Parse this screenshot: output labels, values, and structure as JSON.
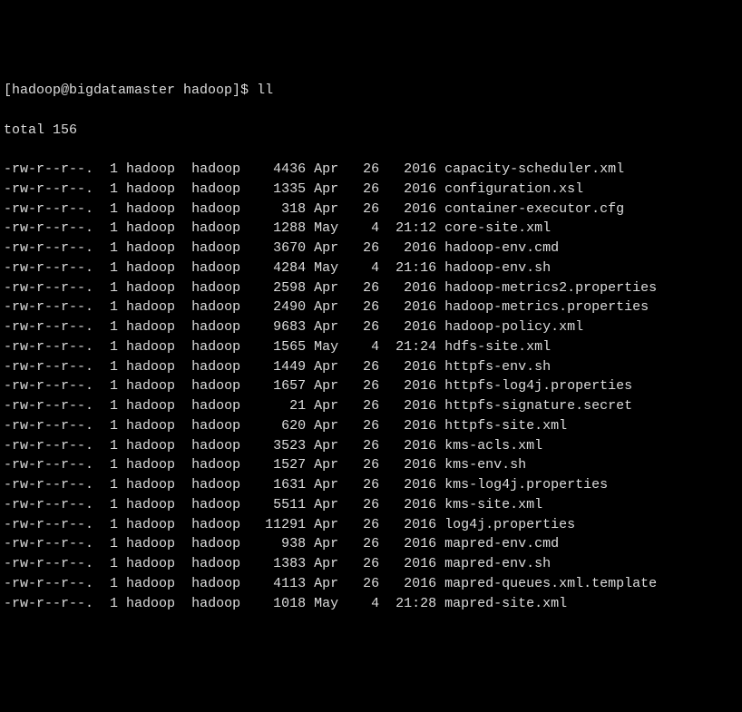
{
  "prompt": {
    "userhost": "[hadoop@bigdatamaster hadoop]$",
    "command": "ll"
  },
  "total_line": "total 156",
  "files": [
    {
      "perms": "-rw-r--r--.",
      "links": "1",
      "owner": "hadoop",
      "group": "hadoop",
      "size": "4436",
      "month": "Apr",
      "day": "26",
      "time": "2016",
      "name": "capacity-scheduler.xml"
    },
    {
      "perms": "-rw-r--r--.",
      "links": "1",
      "owner": "hadoop",
      "group": "hadoop",
      "size": "1335",
      "month": "Apr",
      "day": "26",
      "time": "2016",
      "name": "configuration.xsl"
    },
    {
      "perms": "-rw-r--r--.",
      "links": "1",
      "owner": "hadoop",
      "group": "hadoop",
      "size": "318",
      "month": "Apr",
      "day": "26",
      "time": "2016",
      "name": "container-executor.cfg"
    },
    {
      "perms": "-rw-r--r--.",
      "links": "1",
      "owner": "hadoop",
      "group": "hadoop",
      "size": "1288",
      "month": "May",
      "day": "4",
      "time": "21:12",
      "name": "core-site.xml"
    },
    {
      "perms": "-rw-r--r--.",
      "links": "1",
      "owner": "hadoop",
      "group": "hadoop",
      "size": "3670",
      "month": "Apr",
      "day": "26",
      "time": "2016",
      "name": "hadoop-env.cmd"
    },
    {
      "perms": "-rw-r--r--.",
      "links": "1",
      "owner": "hadoop",
      "group": "hadoop",
      "size": "4284",
      "month": "May",
      "day": "4",
      "time": "21:16",
      "name": "hadoop-env.sh"
    },
    {
      "perms": "-rw-r--r--.",
      "links": "1",
      "owner": "hadoop",
      "group": "hadoop",
      "size": "2598",
      "month": "Apr",
      "day": "26",
      "time": "2016",
      "name": "hadoop-metrics2.properties"
    },
    {
      "perms": "-rw-r--r--.",
      "links": "1",
      "owner": "hadoop",
      "group": "hadoop",
      "size": "2490",
      "month": "Apr",
      "day": "26",
      "time": "2016",
      "name": "hadoop-metrics.properties"
    },
    {
      "perms": "-rw-r--r--.",
      "links": "1",
      "owner": "hadoop",
      "group": "hadoop",
      "size": "9683",
      "month": "Apr",
      "day": "26",
      "time": "2016",
      "name": "hadoop-policy.xml"
    },
    {
      "perms": "-rw-r--r--.",
      "links": "1",
      "owner": "hadoop",
      "group": "hadoop",
      "size": "1565",
      "month": "May",
      "day": "4",
      "time": "21:24",
      "name": "hdfs-site.xml"
    },
    {
      "perms": "-rw-r--r--.",
      "links": "1",
      "owner": "hadoop",
      "group": "hadoop",
      "size": "1449",
      "month": "Apr",
      "day": "26",
      "time": "2016",
      "name": "httpfs-env.sh"
    },
    {
      "perms": "-rw-r--r--.",
      "links": "1",
      "owner": "hadoop",
      "group": "hadoop",
      "size": "1657",
      "month": "Apr",
      "day": "26",
      "time": "2016",
      "name": "httpfs-log4j.properties"
    },
    {
      "perms": "-rw-r--r--.",
      "links": "1",
      "owner": "hadoop",
      "group": "hadoop",
      "size": "21",
      "month": "Apr",
      "day": "26",
      "time": "2016",
      "name": "httpfs-signature.secret"
    },
    {
      "perms": "-rw-r--r--.",
      "links": "1",
      "owner": "hadoop",
      "group": "hadoop",
      "size": "620",
      "month": "Apr",
      "day": "26",
      "time": "2016",
      "name": "httpfs-site.xml"
    },
    {
      "perms": "-rw-r--r--.",
      "links": "1",
      "owner": "hadoop",
      "group": "hadoop",
      "size": "3523",
      "month": "Apr",
      "day": "26",
      "time": "2016",
      "name": "kms-acls.xml"
    },
    {
      "perms": "-rw-r--r--.",
      "links": "1",
      "owner": "hadoop",
      "group": "hadoop",
      "size": "1527",
      "month": "Apr",
      "day": "26",
      "time": "2016",
      "name": "kms-env.sh"
    },
    {
      "perms": "-rw-r--r--.",
      "links": "1",
      "owner": "hadoop",
      "group": "hadoop",
      "size": "1631",
      "month": "Apr",
      "day": "26",
      "time": "2016",
      "name": "kms-log4j.properties"
    },
    {
      "perms": "-rw-r--r--.",
      "links": "1",
      "owner": "hadoop",
      "group": "hadoop",
      "size": "5511",
      "month": "Apr",
      "day": "26",
      "time": "2016",
      "name": "kms-site.xml"
    },
    {
      "perms": "-rw-r--r--.",
      "links": "1",
      "owner": "hadoop",
      "group": "hadoop",
      "size": "11291",
      "month": "Apr",
      "day": "26",
      "time": "2016",
      "name": "log4j.properties"
    },
    {
      "perms": "-rw-r--r--.",
      "links": "1",
      "owner": "hadoop",
      "group": "hadoop",
      "size": "938",
      "month": "Apr",
      "day": "26",
      "time": "2016",
      "name": "mapred-env.cmd"
    },
    {
      "perms": "-rw-r--r--.",
      "links": "1",
      "owner": "hadoop",
      "group": "hadoop",
      "size": "1383",
      "month": "Apr",
      "day": "26",
      "time": "2016",
      "name": "mapred-env.sh"
    },
    {
      "perms": "-rw-r--r--.",
      "links": "1",
      "owner": "hadoop",
      "group": "hadoop",
      "size": "4113",
      "month": "Apr",
      "day": "26",
      "time": "2016",
      "name": "mapred-queues.xml.template"
    },
    {
      "perms": "-rw-r--r--.",
      "links": "1",
      "owner": "hadoop",
      "group": "hadoop",
      "size": "1018",
      "month": "May",
      "day": "4",
      "time": "21:28",
      "name": "mapred-site.xml"
    }
  ]
}
